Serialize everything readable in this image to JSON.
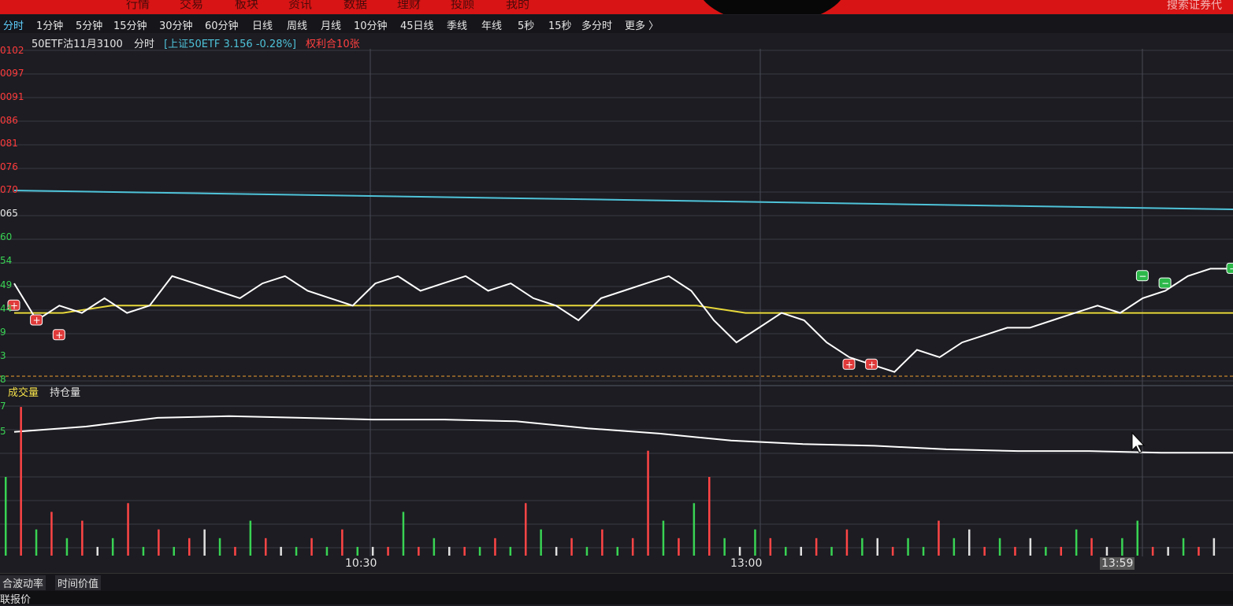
{
  "topbar": {
    "items": [
      "行情",
      "交易",
      "板块",
      "资讯",
      "数据",
      "理财",
      "投顾",
      "我的"
    ],
    "search": "搜索证券代"
  },
  "periods": [
    "分时",
    "1分钟",
    "5分钟",
    "15分钟",
    "30分钟",
    "60分钟",
    "日线",
    "周线",
    "月线",
    "10分钟",
    "45日线",
    "季线",
    "年线",
    "5秒",
    "15秒",
    "多分时",
    "更多 〉"
  ],
  "info": {
    "name": "50ETF沽11月3100",
    "mode": "分时",
    "ref": "[上证50ETF 3.156 -0.28%]",
    "hold": "权利合10张"
  },
  "y_ticks": [
    "0102",
    "0097",
    "0091",
    "086",
    "081",
    "076",
    "070",
    "065",
    "60",
    "54",
    "49",
    "44",
    "9",
    "3",
    "8"
  ],
  "volume_legend": {
    "a": "成交量",
    "b": "持仓量"
  },
  "volume_ticks": [
    "7",
    "5"
  ],
  "x_labels": [
    "10:30",
    "13:00",
    "13:59"
  ],
  "bottom": {
    "tab1": "合波动率",
    "tab2": "时间价值",
    "row2": "联报价"
  },
  "colors": {
    "price_line": "#ffffff",
    "avg_line": "#e8d83a",
    "underlying_line": "#4fc3d9",
    "up_bar": "#ff4545",
    "down_bar": "#39d353",
    "flat_bar": "#e0e0e0",
    "background": "#1c1c22"
  },
  "chart_data": {
    "type": "line",
    "price": [
      0.0049,
      0.0044,
      0.0046,
      0.0045,
      0.0047,
      0.0045,
      0.0046,
      0.005,
      0.0049,
      0.0048,
      0.0047,
      0.0049,
      0.005,
      0.0048,
      0.0047,
      0.0046,
      0.0049,
      0.005,
      0.0048,
      0.0049,
      0.005,
      0.0048,
      0.0049,
      0.0047,
      0.0046,
      0.0044,
      0.0047,
      0.0048,
      0.0049,
      0.005,
      0.0048,
      0.0044,
      0.0041,
      0.0043,
      0.0045,
      0.0044,
      0.0041,
      0.0039,
      0.0038,
      0.0037,
      0.004,
      0.0039,
      0.0041,
      0.0042,
      0.0043,
      0.0043,
      0.0044,
      0.0045,
      0.0046,
      0.0045,
      0.0047,
      0.0048,
      0.005,
      0.0051,
      0.0051
    ],
    "avg": [
      0.0045,
      0.0045,
      0.0046,
      0.0046,
      0.0046,
      0.0046,
      0.0046,
      0.0046,
      0.0046,
      0.0046,
      0.0046,
      0.0046,
      0.0046,
      0.0046,
      0.0046,
      0.0045,
      0.0045,
      0.0045,
      0.0045,
      0.0045,
      0.0045,
      0.0045,
      0.0045,
      0.0045,
      0.0045,
      0.0045
    ],
    "underlying": [
      3.16,
      3.159,
      3.158,
      3.157,
      3.156,
      3.155,
      3.154
    ],
    "open_interest": [
      5.0,
      5.3,
      5.8,
      5.9,
      5.8,
      5.7,
      5.7,
      5.6,
      5.2,
      4.9,
      4.5,
      4.3,
      4.2,
      4.0,
      3.9,
      3.9,
      3.8,
      3.8
    ],
    "volume": [
      9,
      17,
      3,
      5,
      2,
      4,
      1,
      2,
      6,
      1,
      3,
      1,
      2,
      3,
      2,
      1,
      4,
      2,
      1,
      1,
      2,
      1,
      3,
      1,
      1,
      1,
      5,
      1,
      2,
      1,
      1,
      1,
      2,
      1,
      6,
      3,
      1,
      2,
      1,
      3,
      1,
      2,
      12,
      4,
      2,
      6,
      9,
      2,
      1,
      3,
      2,
      1,
      1,
      2,
      1,
      3,
      2,
      2,
      1,
      2,
      1,
      4,
      2,
      3,
      1,
      2,
      1,
      2,
      1,
      1,
      3,
      2,
      1,
      2,
      4,
      1,
      1,
      2,
      1,
      2
    ],
    "volume_dir": [
      1,
      0,
      1,
      0,
      1,
      0,
      2,
      1,
      0,
      1,
      0,
      1,
      0,
      2,
      1,
      0,
      1,
      0,
      2,
      1,
      0,
      1,
      0,
      1,
      2,
      0,
      1,
      0,
      1,
      2,
      0,
      1,
      0,
      1,
      0,
      1,
      2,
      0,
      1,
      0,
      1,
      0,
      0,
      1,
      0,
      1,
      0,
      1,
      2,
      1,
      0,
      1,
      2,
      0,
      1,
      0,
      1,
      2,
      0,
      1,
      1,
      0,
      1,
      2,
      0,
      1,
      0,
      2,
      1,
      0,
      1,
      0,
      2,
      1,
      1,
      0,
      2,
      1,
      0,
      2
    ],
    "x_tick_labels": [
      "10:30",
      "13:00",
      "13:59"
    ],
    "markers": [
      {
        "label": "+",
        "index": 0,
        "value": 0.0046
      },
      {
        "label": "+",
        "index": 1,
        "value": 0.0044
      },
      {
        "label": "+",
        "index": 2,
        "value": 0.0042
      },
      {
        "label": "+",
        "index": 37,
        "value": 0.0038
      },
      {
        "label": "+",
        "index": 38,
        "value": 0.0038
      },
      {
        "label": "−",
        "index": 50,
        "value": 0.005
      },
      {
        "label": "−",
        "index": 51,
        "value": 0.0049
      },
      {
        "label": "−",
        "index": 54,
        "value": 0.0051
      }
    ],
    "grid": true
  }
}
